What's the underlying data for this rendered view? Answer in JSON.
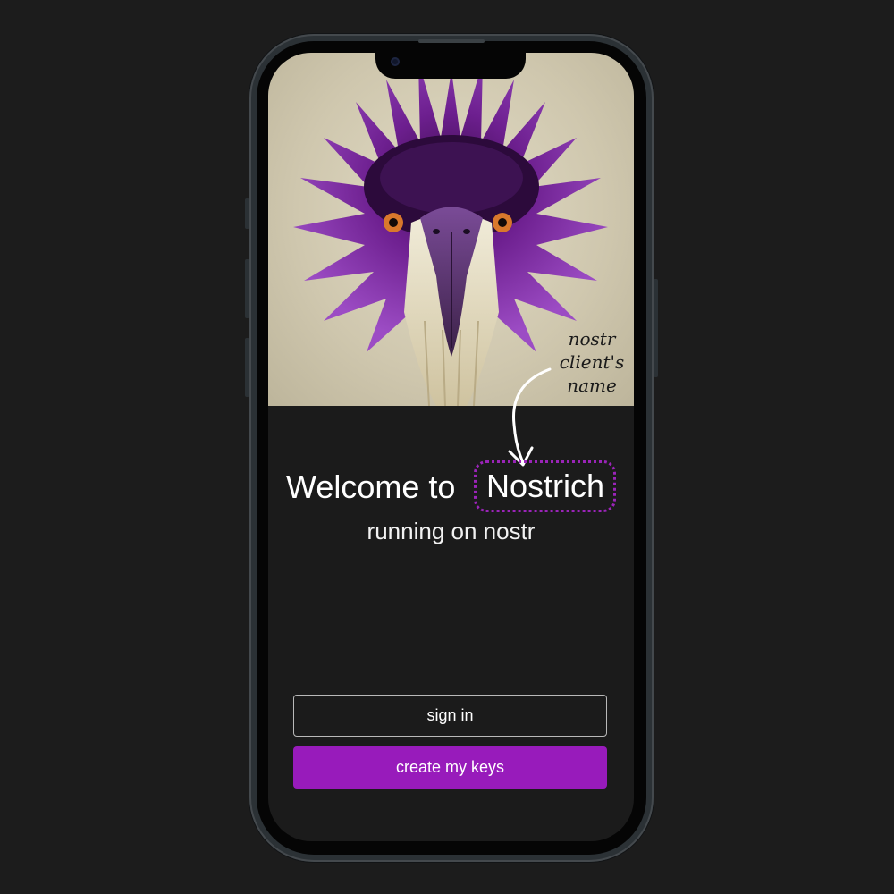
{
  "welcome": {
    "prefix": "Welcome to ",
    "app_name": "Nostrich",
    "subtitle": "running on nostr"
  },
  "annotation": {
    "lines": [
      "nostr",
      "client's",
      "name"
    ]
  },
  "buttons": {
    "sign_in": "sign in",
    "create_keys": "create my keys"
  },
  "colors": {
    "background": "#1c1c1c",
    "screen": "#1b1b1b",
    "accent": "#981bbb",
    "highlight_border": "#9a24b8",
    "outline": "#b9b9b9"
  },
  "icons": {
    "hero": "purple-bird-illustration",
    "arrow": "curved-arrow-icon"
  }
}
